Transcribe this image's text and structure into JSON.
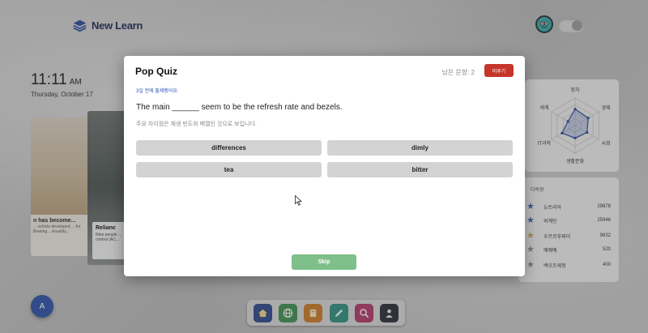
{
  "header": {
    "brand": "New Learn"
  },
  "clock": {
    "time": "11:11",
    "ampm": "AM",
    "date": "Thursday, October 17"
  },
  "news": [
    {
      "title": "n has become...",
      "desc": "... vehicle developed ... for Bearing... visuality..."
    },
    {
      "title": "Relianc",
      "desc": "Nine people ... control (AC..."
    }
  ],
  "radar": {
    "labels": [
      "정치",
      "경제",
      "사회",
      "생활문화",
      "IT과학",
      "세계"
    ],
    "values": [
      0.6,
      0.55,
      0.5,
      0.45,
      0.55,
      0.3
    ]
  },
  "ranking": {
    "title": "다독왕",
    "rows": [
      {
        "name": "뉴트리아",
        "score": "29878",
        "star_color": "#3e5fb3"
      },
      {
        "name": "외계인",
        "score": "25946",
        "star_color": "#3e5fb3"
      },
      {
        "name": "우르르푸짜이",
        "score": "9632",
        "star_color": "#c8a25a"
      },
      {
        "name": "예예예",
        "score": "520",
        "star_color": "#8a8a8a"
      },
      {
        "name": "백오조제형",
        "score": "400",
        "star_color": "#8a8a8a"
      }
    ]
  },
  "avatar_letter": "A",
  "dock": [
    "home-icon",
    "globe-icon",
    "book-icon",
    "pencil-icon",
    "search-icon",
    "person-icon"
  ],
  "quiz": {
    "title": "Pop Quiz",
    "remaining": "남은 문항: 2",
    "later_label": "미루기",
    "ago": "3일 전에 출제됐어요.",
    "sentence": "The main ______ seem to be the refresh rate and bezels.",
    "translation": "주요 차이점은 재생 빈도와 베젤인 것으로 보입니다.",
    "options": [
      "differences",
      "dimly",
      "tea",
      "bitter"
    ],
    "skip_label": "Skip"
  },
  "colors": {
    "later": "#c6352a",
    "skip": "#7fbf8a",
    "ago": "#2d55b5",
    "brand": "#1f2b55"
  }
}
